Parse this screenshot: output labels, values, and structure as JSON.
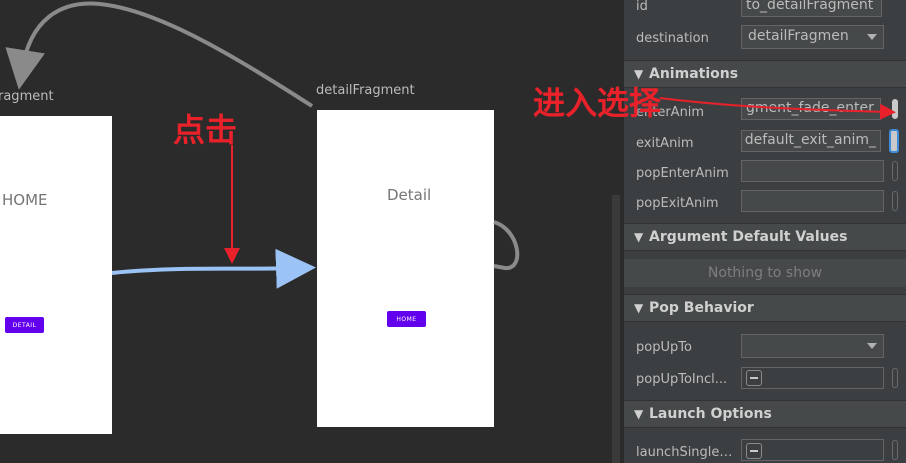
{
  "graph": {
    "home_fragment_label": "ragment",
    "home_screen_text": "HOME",
    "home_button_label": "DETAIL",
    "detail_fragment_label": "detailFragment",
    "detail_screen_text": "Detail",
    "detail_button_label": "HOME"
  },
  "annotations": {
    "click_label": "点击",
    "enter_select_label": "进入选择",
    "color": "#e8212a"
  },
  "properties": {
    "id_label": "id",
    "id_value": "to_detailFragment",
    "destination_label": "destination",
    "destination_value": "detailFragmen",
    "animations_title": "Animations",
    "enter_anim_label": "enterAnim",
    "enter_anim_value": "gment_fade_enter",
    "exit_anim_label": "exitAnim",
    "exit_anim_value": "_default_exit_anim",
    "pop_enter_anim_label": "popEnterAnim",
    "pop_enter_anim_value": "",
    "pop_exit_anim_label": "popExitAnim",
    "pop_exit_anim_value": "",
    "argument_defaults_title": "Argument Default Values",
    "argument_defaults_empty": "Nothing to show",
    "pop_behavior_title": "Pop Behavior",
    "pop_up_to_label": "popUpTo",
    "pop_up_to_value": "",
    "pop_up_to_inclusive_label": "popUpToIncl...",
    "launch_options_title": "Launch Options",
    "launch_single_top_label": "launchSingleT..."
  },
  "colors": {
    "canvas_bg": "#2b2b2b",
    "panel_bg": "#3c3f41",
    "button_purple": "#6200ee",
    "action_arrow": "#9cc3f5"
  }
}
